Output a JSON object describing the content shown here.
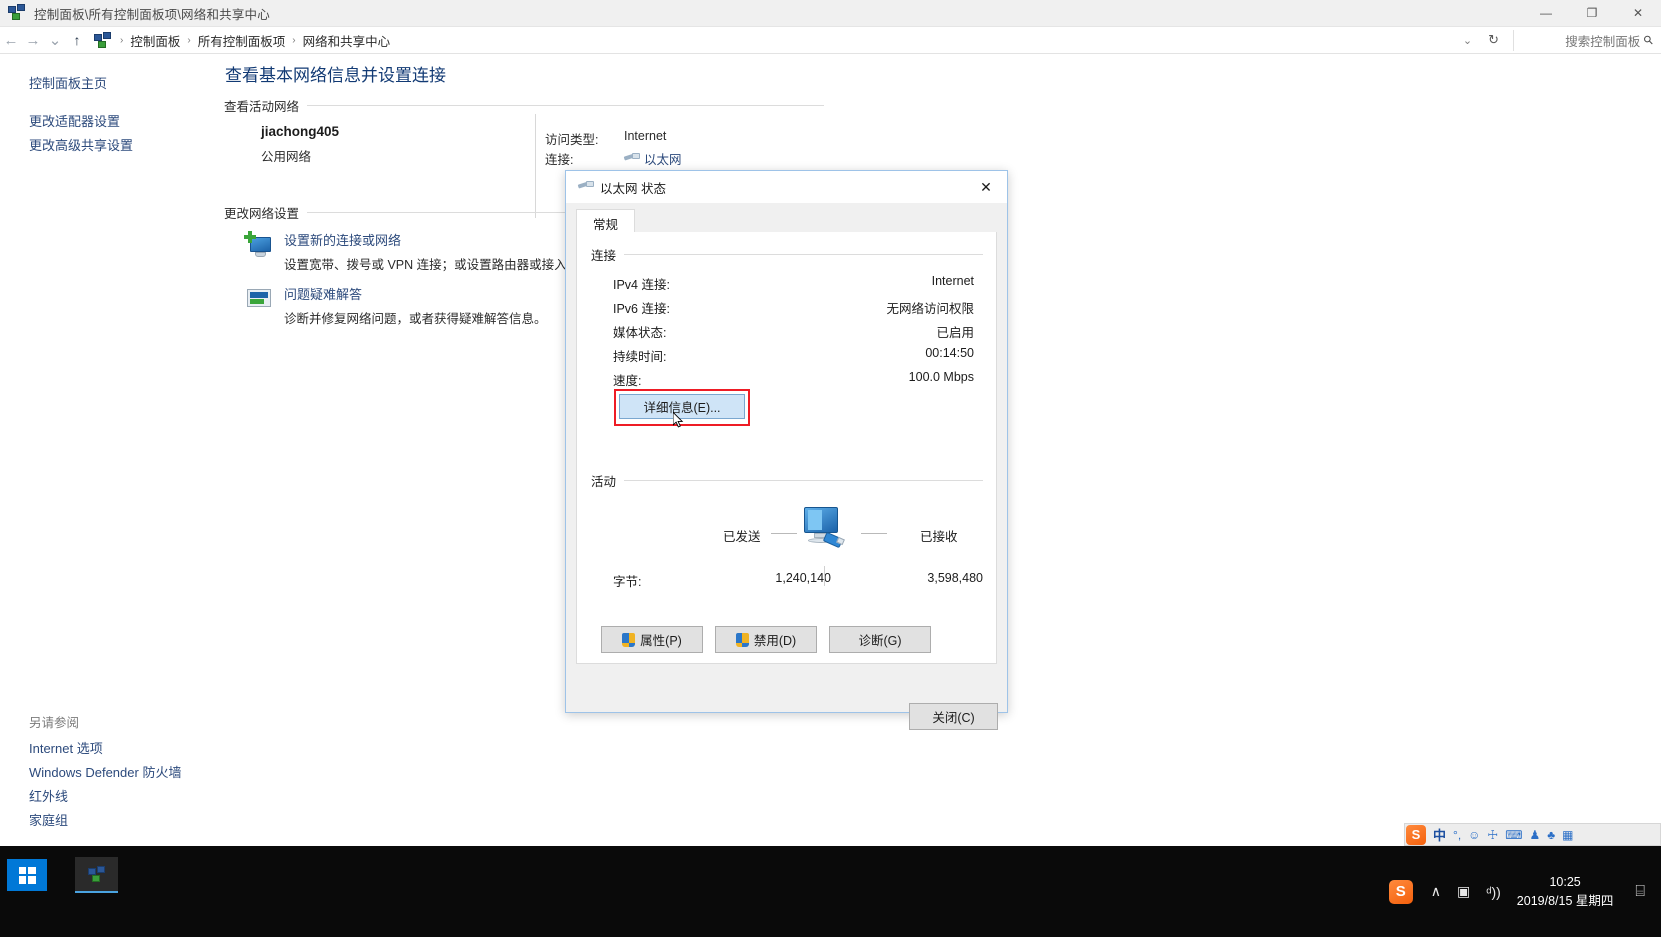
{
  "window": {
    "title": "控制面板\\所有控制面板项\\网络和共享中心",
    "icon": "network-sharing-center-icon",
    "minimize_label": "—",
    "maximize_label": "❐",
    "close_label": "✕"
  },
  "addressbar": {
    "back_label": "←",
    "forward_label": "→",
    "history_label": "⌄",
    "up_label": "↑",
    "crumbs": [
      "控制面板",
      "所有控制面板项",
      "网络和共享中心"
    ],
    "separator": "›",
    "dropdown_label": "⌄",
    "refresh_label": "↻",
    "search_placeholder": "搜索控制面板",
    "search_icon": "⚲"
  },
  "sidebar": {
    "home": "控制面板主页",
    "links": [
      "更改适配器设置",
      "更改高级共享设置"
    ],
    "see_also_header": "另请参阅",
    "see_also": [
      "Internet 选项",
      "Windows Defender 防火墙",
      "红外线",
      "家庭组"
    ]
  },
  "main": {
    "page_title": "查看基本网络信息并设置连接",
    "active_networks_header": "查看活动网络",
    "network": {
      "name": "jiachong405",
      "type": "公用网络",
      "access_label": "访问类型:",
      "access_value": "Internet",
      "connection_label": "连接:",
      "connection_value": "以太网"
    },
    "change_settings_header": "更改网络设置",
    "tasks": [
      {
        "icon": "new-connection-icon",
        "link": "设置新的连接或网络",
        "desc": "设置宽带、拨号或 VPN 连接；或设置路由器或接入点。"
      },
      {
        "icon": "troubleshoot-icon",
        "link": "问题疑难解答",
        "desc": "诊断并修复网络问题，或者获得疑难解答信息。"
      }
    ]
  },
  "dialog": {
    "title": "以太网 状态",
    "icon": "ethernet-icon",
    "close_label": "✕",
    "tab": "常规",
    "connection_section": "连接",
    "rows": [
      {
        "label": "IPv4 连接:",
        "value": "Internet"
      },
      {
        "label": "IPv6 连接:",
        "value": "无网络访问权限"
      },
      {
        "label": "媒体状态:",
        "value": "已启用"
      },
      {
        "label": "持续时间:",
        "value": "00:14:50"
      },
      {
        "label": "速度:",
        "value": "100.0 Mbps"
      }
    ],
    "details_button": "详细信息(E)...",
    "activity_section": "活动",
    "sent_label": "已发送",
    "received_label": "已接收",
    "bytes_label": "字节:",
    "bytes_sent": "1,240,140",
    "bytes_received": "3,598,480",
    "buttons": [
      {
        "label": "属性(P)",
        "shield": true
      },
      {
        "label": "禁用(D)",
        "shield": true
      },
      {
        "label": "诊断(G)",
        "shield": false
      }
    ],
    "close_button": "关闭(C)",
    "highlight_color": "#ee1c25"
  },
  "ime": {
    "logo": "S",
    "mode": "中",
    "icons": [
      "°,",
      "☺",
      "☩",
      "⌨",
      "♟",
      "♣",
      "▦"
    ]
  },
  "taskbar": {
    "start_label": "start-button",
    "app_icon": "control-panel-icon",
    "tray": {
      "sogou": "S",
      "chevron": "∧",
      "network": "▣",
      "volume": "ᵈ))",
      "time": "10:25",
      "date": "2019/8/15 星期四",
      "notification": "⌸"
    }
  }
}
